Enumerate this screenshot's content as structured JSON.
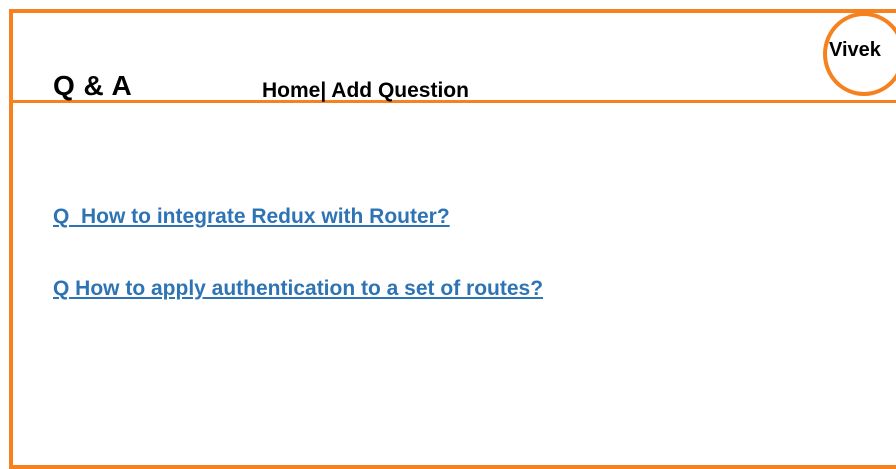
{
  "header": {
    "title": "Q & A",
    "nav": {
      "home_label": "Home",
      "separator": "|",
      "add_question_label": " Add Question"
    },
    "user": {
      "name": "Vivek"
    }
  },
  "questions": [
    {
      "label": "Q  How to integrate Redux with Router?"
    },
    {
      "label": "Q How to apply authentication to a set of routes?"
    }
  ],
  "colors": {
    "accent": "#f5821f",
    "link": "#2e74b5"
  }
}
